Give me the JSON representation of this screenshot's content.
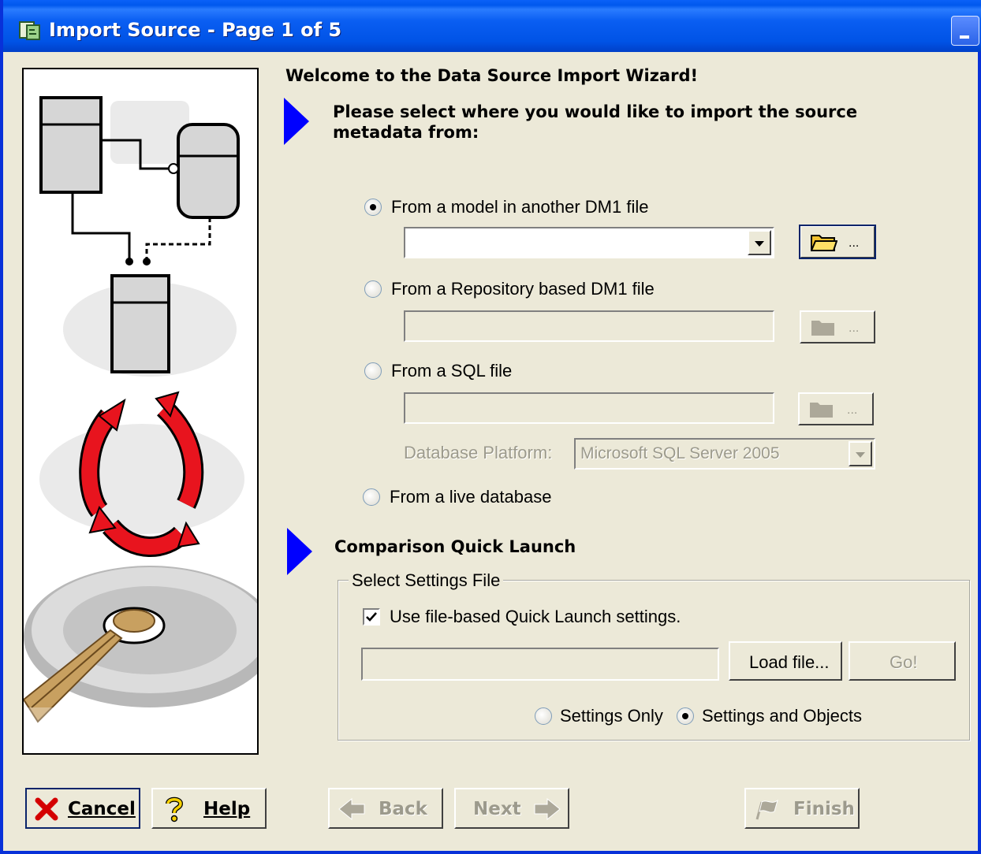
{
  "window": {
    "title": "Import Source - Page 1 of 5"
  },
  "heading": {
    "welcome": "Welcome to the Data Source Import Wizard!",
    "instruction_line1": "Please select where you would like to import the source",
    "instruction_line2": "metadata from:"
  },
  "sources": {
    "model_file": {
      "label": "From a model in another DM1 file",
      "selected": true,
      "value": ""
    },
    "repository_file": {
      "label": "From a Repository based DM1 file",
      "selected": false,
      "value": ""
    },
    "sql_file": {
      "label": "From a SQL file",
      "selected": false,
      "value": ""
    },
    "platform_label": "Database Platform:",
    "platform_value": "Microsoft SQL Server 2005",
    "live_database": {
      "label": "From a live database",
      "selected": false
    },
    "browse_dots": "..."
  },
  "quick_launch": {
    "heading": "Comparison Quick Launch",
    "group_title": "Select Settings File",
    "use_file_label": "Use file-based Quick Launch settings.",
    "use_file_checked": true,
    "file_value": "",
    "load_button": "Load file...",
    "go_button": "Go!",
    "settings_only": "Settings Only",
    "settings_and_objects": "Settings and Objects",
    "selected_option": "Settings and Objects"
  },
  "buttons": {
    "cancel": "Cancel",
    "help": "Help",
    "back": "Back",
    "next": "Next",
    "finish": "Finish"
  },
  "colors": {
    "accent_triangle": "#0000ff",
    "window_bg": "#ece9d8",
    "titlebar": "#0058ee"
  }
}
